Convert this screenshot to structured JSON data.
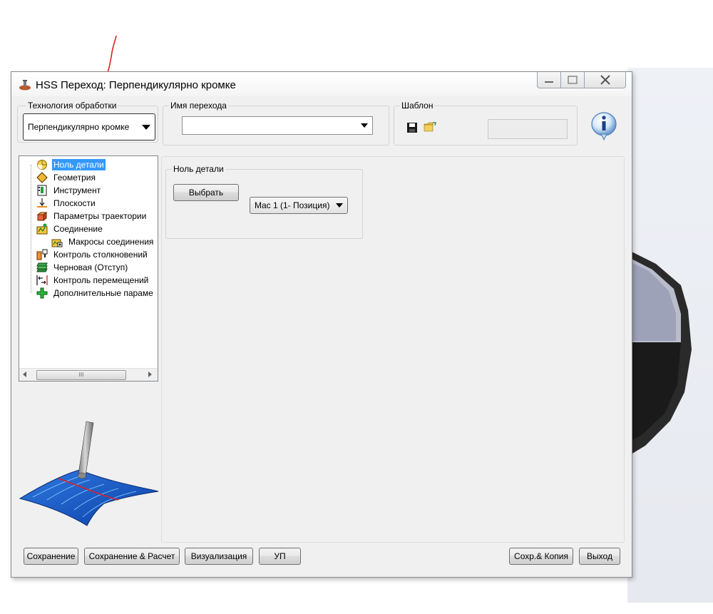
{
  "window": {
    "title": "HSS Переход: Перпендикулярно кромке"
  },
  "technology": {
    "label": "Технология обработки",
    "value": "Перпендикулярно кромке"
  },
  "transition_name": {
    "label": "Имя перехода",
    "value": ""
  },
  "template": {
    "label": "Шаблон",
    "save_icon": "save-icon",
    "open_icon": "folder-open-icon",
    "field_value": ""
  },
  "info_icon": "info-icon",
  "tree": {
    "items": [
      {
        "label": "Ноль детали",
        "icon": "part-zero-icon",
        "selected": true
      },
      {
        "label": "Геометрия",
        "icon": "geometry-icon"
      },
      {
        "label": "Инструмент",
        "icon": "tool-icon"
      },
      {
        "label": "Плоскости",
        "icon": "planes-icon"
      },
      {
        "label": "Параметры траектории",
        "icon": "path-params-icon"
      },
      {
        "label": "Соединение",
        "icon": "link-icon"
      },
      {
        "label": "Макросы соединения",
        "icon": "link-macros-icon"
      },
      {
        "label": "Контроль столкновений",
        "icon": "collision-icon"
      },
      {
        "label": "Черновая (Отступ)",
        "icon": "roughing-icon"
      },
      {
        "label": "Контроль перемещений",
        "icon": "motion-control-icon"
      },
      {
        "label": "Дополнительные параме",
        "icon": "additional-icon"
      }
    ],
    "scroll_thumb_grip": "III"
  },
  "part_zero": {
    "label": "Ноль детали",
    "select_button": "Выбрать",
    "mac_value": "Mac 1 (1- Позиция)"
  },
  "footer": {
    "save": "Сохранение",
    "save_calc": "Сохранение & Расчет",
    "visualize": "Визуализация",
    "up": "УП",
    "save_copy": "Сохр.& Копия",
    "exit": "Выход"
  }
}
